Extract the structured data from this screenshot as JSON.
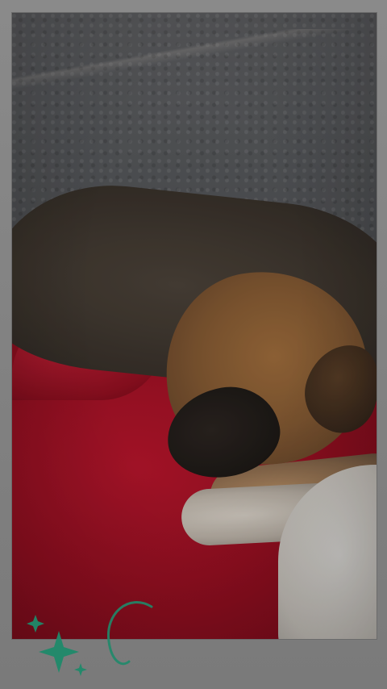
{
  "image": {
    "subject": "dog",
    "colors": {
      "frame": "#7d7d7d",
      "wall": "#55575a",
      "blanket": "#9c1023",
      "dog_fur": "#845a33",
      "dog_dark": "#3f372f",
      "paw": "#bdb4a9",
      "sparkle": "#1f8a6a"
    }
  },
  "decorations": {
    "sparkles": [
      "sparkle-large-icon",
      "sparkle-small-icon",
      "sparkle-tiny-icon"
    ],
    "swirl": "swirl-icon"
  }
}
